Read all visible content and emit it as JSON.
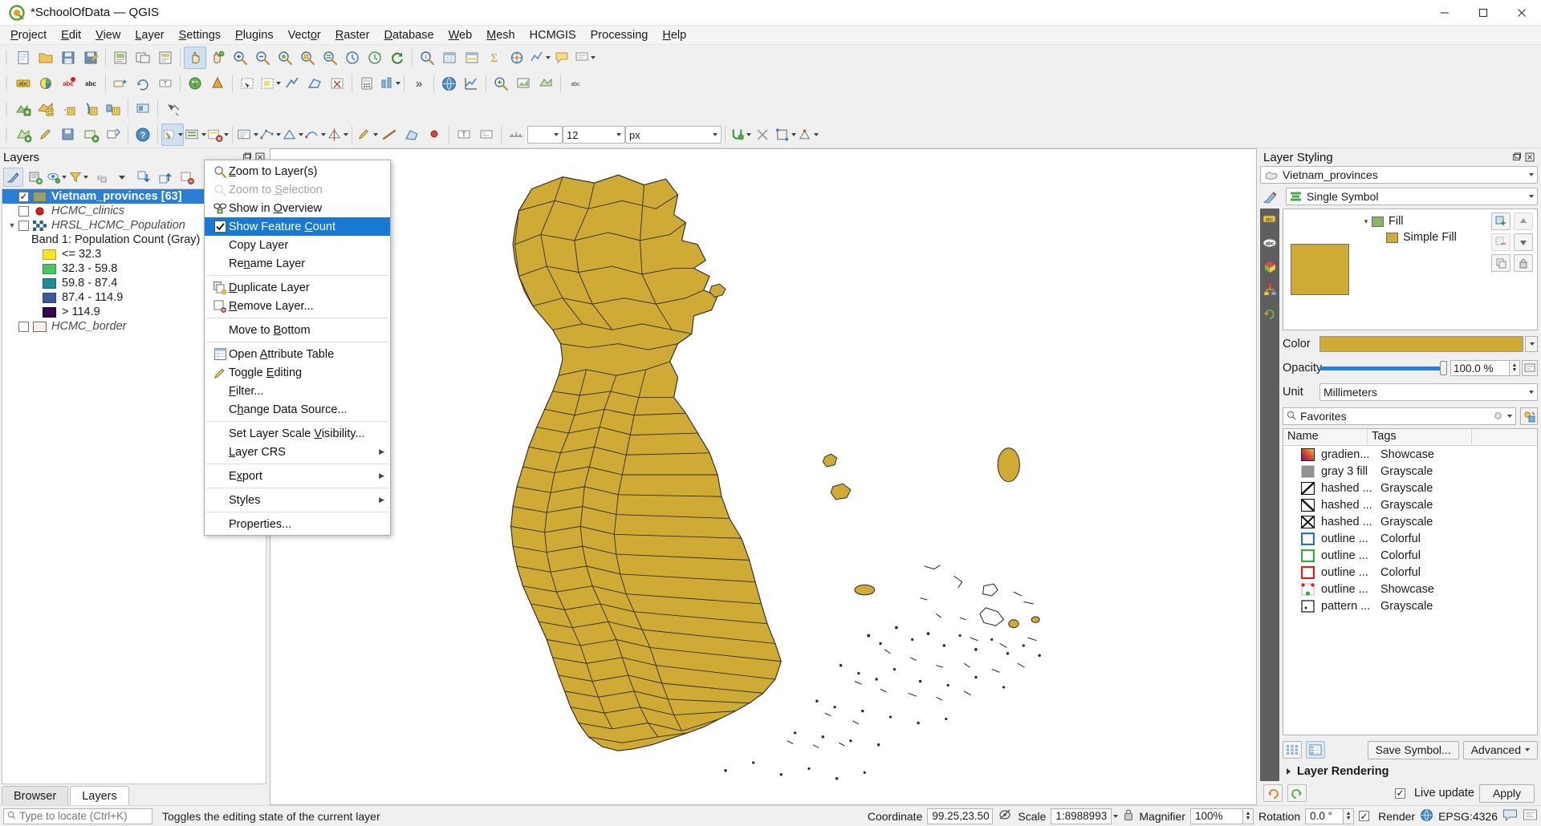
{
  "window": {
    "title": "*SchoolOfData — QGIS",
    "minimize": "—",
    "maximize": "▢",
    "close": "✕"
  },
  "menubar": [
    {
      "label": "Project",
      "accel": "P"
    },
    {
      "label": "Edit",
      "accel": "E"
    },
    {
      "label": "View",
      "accel": "V"
    },
    {
      "label": "Layer",
      "accel": "L"
    },
    {
      "label": "Settings",
      "accel": "S"
    },
    {
      "label": "Plugins",
      "accel": "P"
    },
    {
      "label": "Vector",
      "accel": "o"
    },
    {
      "label": "Raster",
      "accel": "R"
    },
    {
      "label": "Database",
      "accel": "D"
    },
    {
      "label": "Web",
      "accel": "W"
    },
    {
      "label": "Mesh",
      "accel": "M"
    },
    {
      "label": "HCMGIS",
      "accel": ""
    },
    {
      "label": "Processing",
      "accel": ""
    },
    {
      "label": "Help",
      "accel": "H"
    }
  ],
  "toolbar3": {
    "overflow": "»",
    "size_value": "12",
    "unit_value": "px"
  },
  "layers_panel": {
    "title": "Layers",
    "float_icon": "float-icon",
    "close_icon": "close-icon",
    "toolbar": [
      {
        "name": "open-layer-styling-panel",
        "active": true
      },
      {
        "name": "add-group"
      },
      {
        "name": "manage-map-themes"
      },
      {
        "name": "filter-legend-by-map-content"
      },
      {
        "name": "filter-legend-by-expression"
      },
      {
        "name": "expand-all"
      },
      {
        "name": "collapse-all"
      },
      {
        "name": "remove-layer-group"
      }
    ],
    "items": [
      {
        "name": "Vietnam_provinces [63]",
        "checked": true,
        "selected": true,
        "symbol": "polygon-fill",
        "color": "#9aa063"
      },
      {
        "name": "HCMC_clinics",
        "checked": false,
        "selected": false,
        "symbol": "point-marker",
        "color": "#d21f1f"
      },
      {
        "name": "HRSL_HCMC_Population",
        "checked": false,
        "selected": false,
        "symbol": "raster-checker",
        "expandable": true,
        "band_label": "Band 1: Population Count (Gray)",
        "classes": [
          {
            "label": "<= 32.3",
            "color": "#f9e22c"
          },
          {
            "label": "32.3 - 59.8",
            "color": "#4cc262"
          },
          {
            "label": "59.8 - 87.4",
            "color": "#1c8f92"
          },
          {
            "label": "87.4 - 114.9",
            "color": "#3a5a9b"
          },
          {
            "label": "> 114.9",
            "color": "#36004f"
          }
        ]
      },
      {
        "name": "HCMC_border",
        "checked": false,
        "selected": false,
        "symbol": "polygon-fill",
        "color": "#fbeeea"
      }
    ],
    "tabs": [
      {
        "label": "Browser",
        "active": false
      },
      {
        "label": "Layers",
        "active": true
      }
    ]
  },
  "context_menu": {
    "items": [
      {
        "label": "Zoom to Layer(s)",
        "accel": "Z",
        "icon": "zoom-layer-icon",
        "state": "normal"
      },
      {
        "label": "Zoom to Selection",
        "accel": "S",
        "icon": "zoom-selection-icon",
        "state": "disabled"
      },
      {
        "label": "Show in Overview",
        "accel": "O",
        "icon": "overview-icon",
        "state": "normal"
      },
      {
        "label": "Show Feature Count",
        "accel": "C",
        "icon": "checkbox-checked-icon",
        "state": "highlighted"
      },
      {
        "label": "Copy Layer",
        "accel": "",
        "icon": "",
        "state": "normal"
      },
      {
        "label": "Rename Layer",
        "accel": "n",
        "icon": "",
        "state": "normal"
      },
      {
        "separator": true
      },
      {
        "label": "Duplicate Layer",
        "accel": "D",
        "icon": "duplicate-layer-icon",
        "state": "normal"
      },
      {
        "label": "Remove Layer...",
        "accel": "R",
        "icon": "remove-layer-icon",
        "state": "normal"
      },
      {
        "separator": true
      },
      {
        "label": "Move to Bottom",
        "accel": "B",
        "icon": "",
        "state": "normal"
      },
      {
        "separator": true
      },
      {
        "label": "Open Attribute Table",
        "accel": "A",
        "icon": "attribute-table-icon",
        "state": "normal"
      },
      {
        "label": "Toggle Editing",
        "accel": "E",
        "icon": "pencil-icon",
        "state": "normal"
      },
      {
        "label": "Filter...",
        "accel": "F",
        "icon": "",
        "state": "normal"
      },
      {
        "label": "Change Data Source...",
        "accel": "h",
        "icon": "",
        "state": "normal"
      },
      {
        "separator": true
      },
      {
        "label": "Set Layer Scale Visibility...",
        "accel": "V",
        "icon": "",
        "state": "normal"
      },
      {
        "label": "Layer CRS",
        "accel": "L",
        "icon": "",
        "state": "normal",
        "submenu": true
      },
      {
        "separator": true
      },
      {
        "label": "Export",
        "accel": "x",
        "icon": "",
        "state": "normal",
        "submenu": true
      },
      {
        "separator": true
      },
      {
        "label": "Styles",
        "accel": "",
        "icon": "",
        "state": "normal",
        "submenu": true
      },
      {
        "separator": true
      },
      {
        "label": "Properties...",
        "accel": "",
        "icon": "",
        "state": "normal"
      }
    ]
  },
  "layer_styling": {
    "title": "Layer Styling",
    "float_icon": "float-icon",
    "close_icon": "close-icon",
    "layer_selector": "Vietnam_provinces",
    "renderer": "Single Symbol",
    "vtabs": [
      "symbology-icon",
      "labels-icon",
      "masks-icon",
      "3d-view-icon",
      "diagrams-icon",
      "history-icon"
    ],
    "symbol_tree": [
      {
        "label": "Fill",
        "level": 0,
        "color": "#8fb35e",
        "expander": "▾"
      },
      {
        "label": "Simple Fill",
        "level": 1,
        "color": "#cfab36"
      }
    ],
    "preview_color": "#cfab36",
    "color_label": "Color",
    "color_value": "#cfab36",
    "opacity_label": "Opacity",
    "opacity_value": "100.0 %",
    "unit_label": "Unit",
    "unit_value": "Millimeters",
    "search_placeholder": "Favorites",
    "search_value": "Favorites",
    "table_headers": [
      "Name",
      "Tags"
    ],
    "symbols": [
      {
        "name": "gradien...",
        "tags": "Showcase",
        "icon": "gradient-swatch"
      },
      {
        "name": "gray 3 fill",
        "tags": "Grayscale",
        "icon": "gray-swatch"
      },
      {
        "name": "hashed ...",
        "tags": "Grayscale",
        "icon": "hashed-fwd-swatch"
      },
      {
        "name": "hashed ...",
        "tags": "Grayscale",
        "icon": "hashed-back-swatch"
      },
      {
        "name": "hashed ...",
        "tags": "Grayscale",
        "icon": "hashed-cross-swatch"
      },
      {
        "name": "outline ...",
        "tags": "Colorful",
        "icon": "outline-blue-swatch"
      },
      {
        "name": "outline ...",
        "tags": "Colorful",
        "icon": "outline-green-swatch"
      },
      {
        "name": "outline ...",
        "tags": "Colorful",
        "icon": "outline-red-swatch"
      },
      {
        "name": "outline ...",
        "tags": "Showcase",
        "icon": "outline-marker-swatch"
      },
      {
        "name": "pattern ...",
        "tags": "Grayscale",
        "icon": "pattern-dot-swatch"
      }
    ],
    "save_symbol_label": "Save Symbol...",
    "advanced_label": "Advanced",
    "layer_rendering_label": "Layer Rendering",
    "live_update_label": "Live update",
    "live_update_checked": true,
    "apply_label": "Apply",
    "undo_icon": "undo-icon",
    "redo_icon": "redo-icon"
  },
  "statusbar": {
    "locator_placeholder": "Type to locate (Ctrl+K)",
    "message": "Toggles the editing state of the current layer",
    "coordinate_label": "Coordinate",
    "coordinate_value": "99.25,23.50",
    "scale_label": "Scale",
    "scale_value": "1:8988993",
    "magnifier_label": "Magnifier",
    "magnifier_value": "100%",
    "rotation_label": "Rotation",
    "rotation_value": "0.0 °",
    "render_label": "Render",
    "render_checked": true,
    "crs_value": "EPSG:4326"
  }
}
